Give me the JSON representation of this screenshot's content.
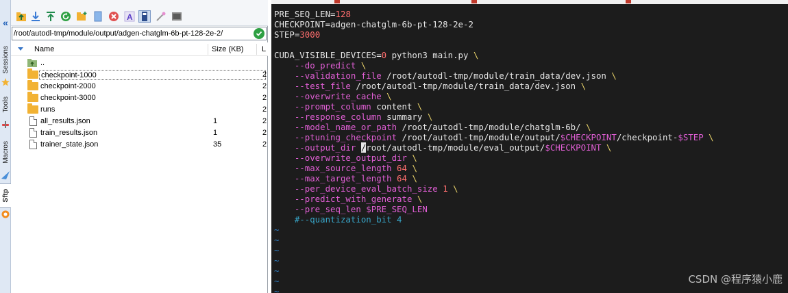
{
  "side_tabs": {
    "sessions": "Sessions",
    "tools": "Tools",
    "macros": "Macros",
    "sftp": "Sftp"
  },
  "sftp": {
    "path": "/root/autodl-tmp/module/output/adgen-chatglm-6b-pt-128-2e-2/",
    "columns": {
      "name": "Name",
      "size": "Size (KB)",
      "last": "L"
    },
    "files": [
      {
        "name": "..",
        "size": "",
        "last": "",
        "type": "parent"
      },
      {
        "name": "checkpoint-1000",
        "size": "",
        "last": "2",
        "type": "folder"
      },
      {
        "name": "checkpoint-2000",
        "size": "",
        "last": "2",
        "type": "folder"
      },
      {
        "name": "checkpoint-3000",
        "size": "",
        "last": "2",
        "type": "folder"
      },
      {
        "name": "runs",
        "size": "",
        "last": "2",
        "type": "folder"
      },
      {
        "name": "all_results.json",
        "size": "1",
        "last": "2",
        "type": "file"
      },
      {
        "name": "train_results.json",
        "size": "1",
        "last": "2",
        "type": "file"
      },
      {
        "name": "trainer_state.json",
        "size": "35",
        "last": "2",
        "type": "file"
      }
    ],
    "toolbar_icons": [
      "parent-folder-icon",
      "download-icon",
      "upload-icon",
      "refresh-icon",
      "new-folder-icon",
      "new-file-icon",
      "delete-icon",
      "rename-icon",
      "terminal-follow-icon",
      "magic-wand-icon",
      "console-icon"
    ]
  },
  "terminal": {
    "lines": [
      [
        [
          "c-txt",
          "PRE_SEQ_LEN="
        ],
        [
          "c-num",
          "128"
        ]
      ],
      [
        [
          "c-txt",
          "CHECKPOINT=adgen-chatglm-6b-pt-128-2e-2"
        ]
      ],
      [
        [
          "c-txt",
          "STEP="
        ],
        [
          "c-num",
          "3000"
        ]
      ],
      [],
      [
        [
          "c-txt",
          "CUDA_VISIBLE_DEVICES="
        ],
        [
          "c-num",
          "0"
        ],
        [
          "c-txt",
          " python3 main.py "
        ],
        [
          "c-bs",
          "\\"
        ]
      ],
      [
        [
          "c-flag",
          "    --do_predict "
        ],
        [
          "c-bs",
          "\\"
        ]
      ],
      [
        [
          "c-flag",
          "    --validation_file "
        ],
        [
          "c-txt",
          "/root/autodl-tmp/module/train_data/dev.json "
        ],
        [
          "c-bs",
          "\\"
        ]
      ],
      [
        [
          "c-flag",
          "    --test_file "
        ],
        [
          "c-txt",
          "/root/autodl-tmp/module/train_data/dev.json "
        ],
        [
          "c-bs",
          "\\"
        ]
      ],
      [
        [
          "c-flag",
          "    --overwrite_cache "
        ],
        [
          "c-bs",
          "\\"
        ]
      ],
      [
        [
          "c-flag",
          "    --prompt_column "
        ],
        [
          "c-txt",
          "content "
        ],
        [
          "c-bs",
          "\\"
        ]
      ],
      [
        [
          "c-flag",
          "    --response_column "
        ],
        [
          "c-txt",
          "summary "
        ],
        [
          "c-bs",
          "\\"
        ]
      ],
      [
        [
          "c-flag",
          "    --model_name_or_path "
        ],
        [
          "c-txt",
          "/root/autodl-tmp/module/chatglm-6b/ "
        ],
        [
          "c-bs",
          "\\"
        ]
      ],
      [
        [
          "c-flag",
          "    --ptuning_checkpoint "
        ],
        [
          "c-txt",
          "/root/autodl-tmp/module/output/"
        ],
        [
          "c-var",
          "$CHECKPOINT"
        ],
        [
          "c-txt",
          "/checkpoint-"
        ],
        [
          "c-var",
          "$STEP"
        ],
        [
          "c-txt",
          " "
        ],
        [
          "c-bs",
          "\\"
        ]
      ],
      [
        [
          "c-flag",
          "    --output_dir "
        ],
        [
          "cursor",
          "/"
        ],
        [
          "c-txt",
          "root/autodl-tmp/module/eval_output/"
        ],
        [
          "c-var",
          "$CHECKPOINT"
        ],
        [
          "c-txt",
          " "
        ],
        [
          "c-bs",
          "\\"
        ]
      ],
      [
        [
          "c-flag",
          "    --overwrite_output_dir "
        ],
        [
          "c-bs",
          "\\"
        ]
      ],
      [
        [
          "c-flag",
          "    --max_source_length "
        ],
        [
          "c-num",
          "64"
        ],
        [
          "c-txt",
          " "
        ],
        [
          "c-bs",
          "\\"
        ]
      ],
      [
        [
          "c-flag",
          "    --max_target_length "
        ],
        [
          "c-num",
          "64"
        ],
        [
          "c-txt",
          " "
        ],
        [
          "c-bs",
          "\\"
        ]
      ],
      [
        [
          "c-flag",
          "    --per_device_eval_batch_size "
        ],
        [
          "c-num",
          "1"
        ],
        [
          "c-txt",
          " "
        ],
        [
          "c-bs",
          "\\"
        ]
      ],
      [
        [
          "c-flag",
          "    --predict_with_generate "
        ],
        [
          "c-bs",
          "\\"
        ]
      ],
      [
        [
          "c-flag",
          "    --pre_seq_len "
        ],
        [
          "c-var",
          "$PRE_SEQ_LEN"
        ]
      ],
      [
        [
          "c-comment",
          "    #--quantization_bit 4"
        ]
      ],
      [
        [
          "c-tilde",
          "~"
        ]
      ],
      [
        [
          "c-tilde",
          "~"
        ]
      ],
      [
        [
          "c-tilde",
          "~"
        ]
      ],
      [
        [
          "c-tilde",
          "~"
        ]
      ],
      [
        [
          "c-tilde",
          "~"
        ]
      ],
      [
        [
          "c-tilde",
          "~"
        ]
      ],
      [
        [
          "c-tilde",
          "~"
        ]
      ]
    ],
    "watermark": "CSDN @程序猿小鹿"
  }
}
